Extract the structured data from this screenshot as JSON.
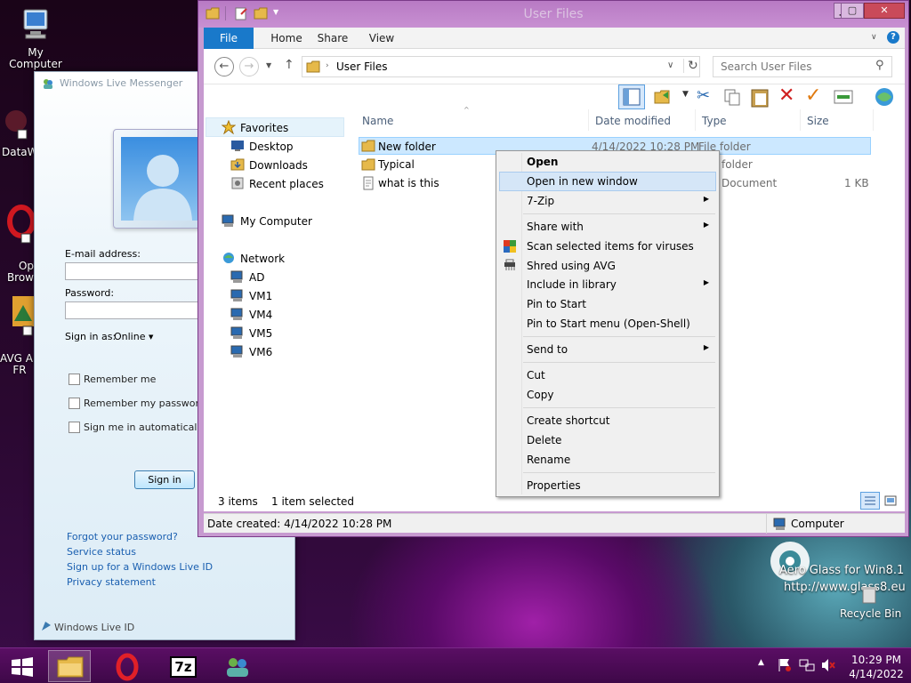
{
  "desktop": {
    "icons": [
      {
        "label": "My Computer"
      },
      {
        "label": "DataW"
      },
      {
        "label": "Op\nBrow"
      },
      {
        "label": "AVG Ap\nFR"
      }
    ],
    "recycle_bin": "Recycle Bin",
    "watermark_line1": "Aero Glass for Win8.1",
    "watermark_line2": "http://www.glass8.eu"
  },
  "messenger": {
    "title": "Windows Live Messenger",
    "email_label": "E-mail address:",
    "email_value": "",
    "password_label": "Password:",
    "password_value": "",
    "sign_in_as_label": "Sign in as:",
    "sign_in_as_value": "Online",
    "remember_me": "Remember me",
    "remember_password": "Remember my password",
    "sign_in_auto": "Sign me in automatically",
    "sign_in_button": "Sign in",
    "links": [
      "Forgot your password?",
      "Service status",
      "Sign up for a Windows Live ID",
      "Privacy statement"
    ],
    "footer": "Windows Live ID"
  },
  "explorer": {
    "title": "User Files",
    "tabs": [
      "File",
      "Home",
      "Share",
      "View"
    ],
    "address": "User Files",
    "search_placeholder": "Search User Files",
    "nav": {
      "favorites": "Favorites",
      "desktop": "Desktop",
      "downloads": "Downloads",
      "recent": "Recent places",
      "computer": "My Computer",
      "network": "Network",
      "hosts": [
        "AD",
        "VM1",
        "VM4",
        "VM5",
        "VM6"
      ]
    },
    "columns": [
      "Name",
      "Date modified",
      "Type",
      "Size"
    ],
    "files": [
      {
        "name": "New folder",
        "date": "4/14/2022 10:28 PM",
        "type": "File folder",
        "size": ""
      },
      {
        "name": "Typical",
        "date": "",
        "type": "folder",
        "size": ""
      },
      {
        "name": "what is this",
        "date": "",
        "type": "Document",
        "size": "1 KB"
      }
    ],
    "status_items": "3 items",
    "status_selected": "1 item selected",
    "details_date": "Date created: 4/14/2022 10:28 PM",
    "details_location": "Computer"
  },
  "context_menu": {
    "open": "Open",
    "open_new_window": "Open in new window",
    "zip": "7-Zip",
    "share_with": "Share with",
    "scan": "Scan selected items for viruses",
    "shred": "Shred using AVG",
    "include_library": "Include in library",
    "pin_start": "Pin to Start",
    "pin_start_menu": "Pin to Start menu (Open-Shell)",
    "send_to": "Send to",
    "cut": "Cut",
    "copy": "Copy",
    "create_shortcut": "Create shortcut",
    "delete": "Delete",
    "rename": "Rename",
    "properties": "Properties"
  },
  "taskbar": {
    "time": "10:29 PM",
    "date": "4/14/2022",
    "zip_label": "7z"
  },
  "colors": {
    "accent": "#1979ca",
    "selection": "#cce8ff",
    "frame": "#c79ad0"
  }
}
